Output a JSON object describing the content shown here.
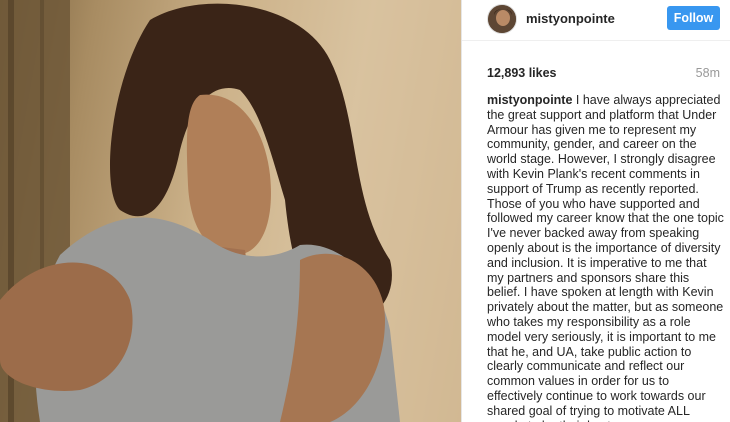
{
  "post": {
    "username": "mistyonpointe",
    "follow_label": "Follow",
    "likes": "12,893 likes",
    "timestamp": "58m",
    "caption_author": "mistyonpointe",
    "caption_text": "I have always appreciated the great support and platform that Under Armour has given me to represent my community, gender, and career on the world stage. However, I strongly disagree with Kevin Plank's recent comments in support of Trump as recently reported. Those of you who have supported and followed my career know that the one topic I've never backed away from speaking openly about is the importance of diversity and inclusion. It is imperative to me that my partners and sponsors share this belief. I have spoken at length with Kevin privately about the matter, but as someone who takes my responsibility as a role model very seriously, it is important to me that he, and UA, take public action to clearly communicate and reflect our common values in order for us to effectively continue to work towards our shared goal of trying to motivate ALL people to be their best"
  },
  "colors": {
    "follow_button": "#3897f0",
    "timestamp": "#999999",
    "text": "#262626"
  }
}
